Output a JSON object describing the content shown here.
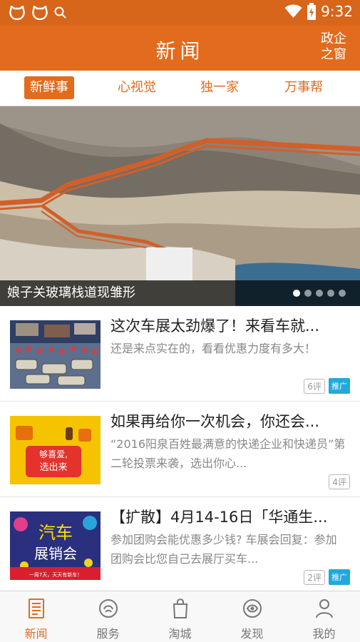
{
  "status": {
    "time": "9:32",
    "icons": [
      "cat-face-icon",
      "cat-face-icon",
      "search-icon",
      "wifi-icon",
      "battery-icon"
    ]
  },
  "header": {
    "title": "新闻",
    "right_button": "政企之窗"
  },
  "tabs": [
    {
      "label": "新鲜事",
      "active": true
    },
    {
      "label": "心视觉",
      "active": false
    },
    {
      "label": "独一家",
      "active": false
    },
    {
      "label": "万事帮",
      "active": false
    }
  ],
  "banner": {
    "caption": "娘子关玻璃栈道现雏形",
    "page_count": 5,
    "active_page": 1
  },
  "news": [
    {
      "title": "这次车展太劲爆了！来看车就...",
      "summary": "还是来点实在的，看看优惠力度有多大！",
      "comments": "6评",
      "promo": "推广"
    },
    {
      "title": "如果再给你一次机会，你还会...",
      "summary": "“2016阳泉百姓最满意的快递企业和快递员”第二轮投票来袭，选出你心...",
      "comments": "4评",
      "thumb_text_1": "够喜爱,",
      "thumb_text_2": "选出来"
    },
    {
      "title": "【扩散】4月14-16日「华通生...",
      "summary": "参加团购会能优惠多少钱? 车展会回复：参加团购会比您自己去展厅买车...",
      "comments": "2评",
      "promo": "推广",
      "thumb_text_1": "汽车",
      "thumb_text_2": "展销会",
      "thumb_text_3": "一周7天，天天有新车！"
    }
  ],
  "bottom_nav": [
    {
      "label": "新闻",
      "icon": "newspaper-icon",
      "active": true
    },
    {
      "label": "服务",
      "icon": "service-icon",
      "active": false
    },
    {
      "label": "淘城",
      "icon": "shopping-bag-icon",
      "active": false
    },
    {
      "label": "发现",
      "icon": "discover-icon",
      "active": false
    },
    {
      "label": "我的",
      "icon": "profile-icon",
      "active": false
    }
  ],
  "colors": {
    "primary": "#e26b1d",
    "promo": "#23a8dc"
  }
}
